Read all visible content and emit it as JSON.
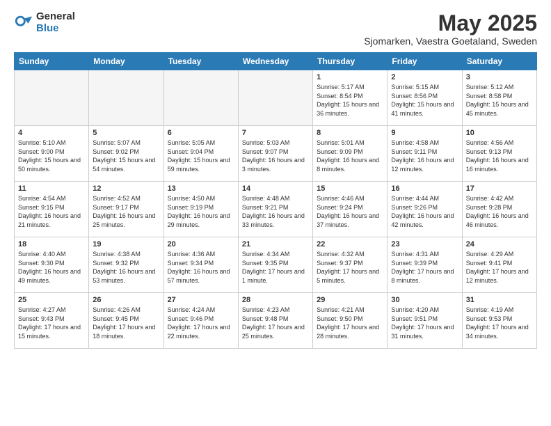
{
  "header": {
    "logo_general": "General",
    "logo_blue": "Blue",
    "title": "May 2025",
    "subtitle": "Sjomarken, Vaestra Goetaland, Sweden"
  },
  "days_of_week": [
    "Sunday",
    "Monday",
    "Tuesday",
    "Wednesday",
    "Thursday",
    "Friday",
    "Saturday"
  ],
  "weeks": [
    [
      {
        "day": "",
        "info": ""
      },
      {
        "day": "",
        "info": ""
      },
      {
        "day": "",
        "info": ""
      },
      {
        "day": "",
        "info": ""
      },
      {
        "day": "1",
        "info": "Sunrise: 5:17 AM\nSunset: 8:54 PM\nDaylight: 15 hours and 36 minutes."
      },
      {
        "day": "2",
        "info": "Sunrise: 5:15 AM\nSunset: 8:56 PM\nDaylight: 15 hours and 41 minutes."
      },
      {
        "day": "3",
        "info": "Sunrise: 5:12 AM\nSunset: 8:58 PM\nDaylight: 15 hours and 45 minutes."
      }
    ],
    [
      {
        "day": "4",
        "info": "Sunrise: 5:10 AM\nSunset: 9:00 PM\nDaylight: 15 hours and 50 minutes."
      },
      {
        "day": "5",
        "info": "Sunrise: 5:07 AM\nSunset: 9:02 PM\nDaylight: 15 hours and 54 minutes."
      },
      {
        "day": "6",
        "info": "Sunrise: 5:05 AM\nSunset: 9:04 PM\nDaylight: 15 hours and 59 minutes."
      },
      {
        "day": "7",
        "info": "Sunrise: 5:03 AM\nSunset: 9:07 PM\nDaylight: 16 hours and 3 minutes."
      },
      {
        "day": "8",
        "info": "Sunrise: 5:01 AM\nSunset: 9:09 PM\nDaylight: 16 hours and 8 minutes."
      },
      {
        "day": "9",
        "info": "Sunrise: 4:58 AM\nSunset: 9:11 PM\nDaylight: 16 hours and 12 minutes."
      },
      {
        "day": "10",
        "info": "Sunrise: 4:56 AM\nSunset: 9:13 PM\nDaylight: 16 hours and 16 minutes."
      }
    ],
    [
      {
        "day": "11",
        "info": "Sunrise: 4:54 AM\nSunset: 9:15 PM\nDaylight: 16 hours and 21 minutes."
      },
      {
        "day": "12",
        "info": "Sunrise: 4:52 AM\nSunset: 9:17 PM\nDaylight: 16 hours and 25 minutes."
      },
      {
        "day": "13",
        "info": "Sunrise: 4:50 AM\nSunset: 9:19 PM\nDaylight: 16 hours and 29 minutes."
      },
      {
        "day": "14",
        "info": "Sunrise: 4:48 AM\nSunset: 9:21 PM\nDaylight: 16 hours and 33 minutes."
      },
      {
        "day": "15",
        "info": "Sunrise: 4:46 AM\nSunset: 9:24 PM\nDaylight: 16 hours and 37 minutes."
      },
      {
        "day": "16",
        "info": "Sunrise: 4:44 AM\nSunset: 9:26 PM\nDaylight: 16 hours and 42 minutes."
      },
      {
        "day": "17",
        "info": "Sunrise: 4:42 AM\nSunset: 9:28 PM\nDaylight: 16 hours and 46 minutes."
      }
    ],
    [
      {
        "day": "18",
        "info": "Sunrise: 4:40 AM\nSunset: 9:30 PM\nDaylight: 16 hours and 49 minutes."
      },
      {
        "day": "19",
        "info": "Sunrise: 4:38 AM\nSunset: 9:32 PM\nDaylight: 16 hours and 53 minutes."
      },
      {
        "day": "20",
        "info": "Sunrise: 4:36 AM\nSunset: 9:34 PM\nDaylight: 16 hours and 57 minutes."
      },
      {
        "day": "21",
        "info": "Sunrise: 4:34 AM\nSunset: 9:35 PM\nDaylight: 17 hours and 1 minute."
      },
      {
        "day": "22",
        "info": "Sunrise: 4:32 AM\nSunset: 9:37 PM\nDaylight: 17 hours and 5 minutes."
      },
      {
        "day": "23",
        "info": "Sunrise: 4:31 AM\nSunset: 9:39 PM\nDaylight: 17 hours and 8 minutes."
      },
      {
        "day": "24",
        "info": "Sunrise: 4:29 AM\nSunset: 9:41 PM\nDaylight: 17 hours and 12 minutes."
      }
    ],
    [
      {
        "day": "25",
        "info": "Sunrise: 4:27 AM\nSunset: 9:43 PM\nDaylight: 17 hours and 15 minutes."
      },
      {
        "day": "26",
        "info": "Sunrise: 4:26 AM\nSunset: 9:45 PM\nDaylight: 17 hours and 18 minutes."
      },
      {
        "day": "27",
        "info": "Sunrise: 4:24 AM\nSunset: 9:46 PM\nDaylight: 17 hours and 22 minutes."
      },
      {
        "day": "28",
        "info": "Sunrise: 4:23 AM\nSunset: 9:48 PM\nDaylight: 17 hours and 25 minutes."
      },
      {
        "day": "29",
        "info": "Sunrise: 4:21 AM\nSunset: 9:50 PM\nDaylight: 17 hours and 28 minutes."
      },
      {
        "day": "30",
        "info": "Sunrise: 4:20 AM\nSunset: 9:51 PM\nDaylight: 17 hours and 31 minutes."
      },
      {
        "day": "31",
        "info": "Sunrise: 4:19 AM\nSunset: 9:53 PM\nDaylight: 17 hours and 34 minutes."
      }
    ]
  ]
}
